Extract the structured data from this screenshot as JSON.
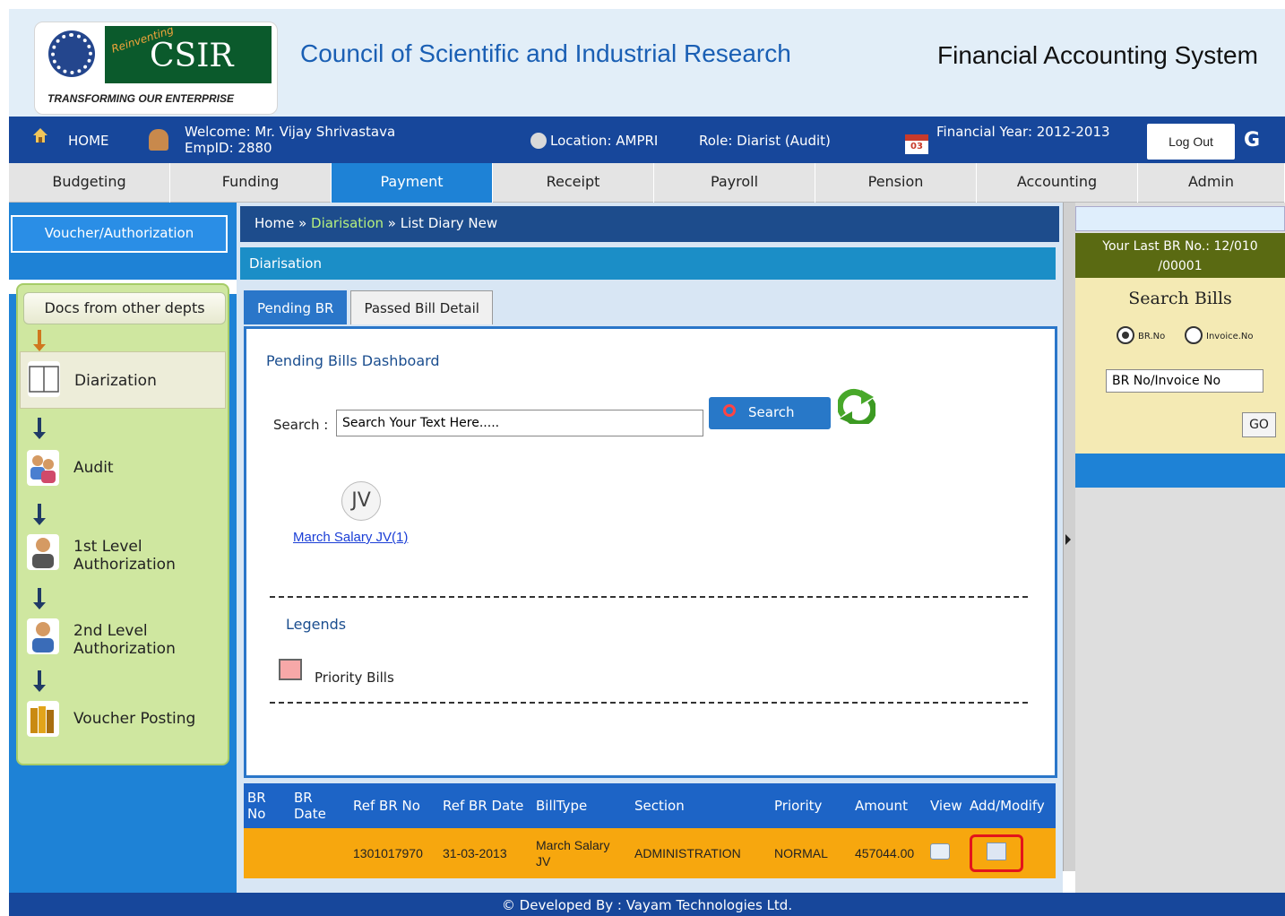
{
  "header": {
    "logo_word": "CSIR",
    "logo_reinventing": "Reinventing",
    "logo_tagline": "TRANSFORMING OUR ENTERPRISE",
    "org_title": "Council of Scientific and Industrial Research",
    "system_title": "Financial Accounting System"
  },
  "infobar": {
    "home_label": "HOME",
    "welcome_line1": "Welcome: Mr. Vijay Shrivastava",
    "welcome_line2": "EmpID: 2880",
    "location": "Location: AMPRI",
    "role": "Role: Diarist (Audit)",
    "calendar_day": "03",
    "financial_year": "Financial Year: 2012-2013",
    "logout_label": "Log Out",
    "logout_icon": "G"
  },
  "menu": {
    "items": [
      "Budgeting",
      "Funding",
      "Payment",
      "Receipt",
      "Payroll",
      "Pension",
      "Accounting",
      "Admin"
    ],
    "active": "Payment"
  },
  "left": {
    "voucher_button": "Voucher/Authorization",
    "docs_button": "Docs from other depts",
    "workflow": [
      {
        "label": "Diarization",
        "icon": "book-icon",
        "selected": true
      },
      {
        "label": "Audit",
        "icon": "users-icon",
        "selected": false
      },
      {
        "label": "1st Level Authorization",
        "icon": "user-icon",
        "selected": false
      },
      {
        "label": "2nd Level Authorization",
        "icon": "user-icon",
        "selected": false
      },
      {
        "label": "Voucher Posting",
        "icon": "books-icon",
        "selected": false
      }
    ]
  },
  "main": {
    "breadcrumb_home": "Home",
    "breadcrumb_sep1": " » ",
    "breadcrumb_section": "Diarisation",
    "breadcrumb_sep2": " » List Diary New",
    "section_title": "Diarisation",
    "tabs": [
      {
        "label": "Pending BR",
        "active": true
      },
      {
        "label": "Passed Bill Detail",
        "active": false
      }
    ],
    "dashboard_title": "Pending Bills Dashboard",
    "search_label": "Search :",
    "search_value": "Search Your Text Here.....",
    "search_button": "Search",
    "jv_badge": "JV",
    "jv_link": "March Salary JV(1)",
    "legends_title": "Legends",
    "legend_priority": "Priority Bills",
    "table": {
      "headers": [
        "BR No",
        "BR Date",
        "Ref BR No",
        "Ref BR Date",
        "BillType",
        "Section",
        "Priority",
        "Amount",
        "View",
        "Add/Modify"
      ],
      "rows": [
        {
          "br_no": "",
          "br_date": "",
          "ref_br_no": "1301017970",
          "ref_br_date": "31-03-2013",
          "bill_type": "March Salary JV",
          "section": "ADMINISTRATION",
          "priority": "NORMAL",
          "amount": "457044.00"
        }
      ]
    }
  },
  "right": {
    "last_br_line1": "Your Last BR No.: 12/010",
    "last_br_line2": "/00001",
    "search_bills_title": "Search Bills",
    "radio_br": "BR.No",
    "radio_invoice": "Invoice.No",
    "radio_selected": "BR.No",
    "br_input_value": "BR No/Invoice No",
    "go_button": "GO"
  },
  "footer": {
    "text": "© Developed By : Vayam Technologies Ltd."
  },
  "colors": {
    "navy": "#17479b",
    "menu_active": "#1e82d6",
    "row_highlight": "#f7a70e",
    "workflow_bg": "#cfe7a0",
    "highlight_box": "#e3141b"
  }
}
